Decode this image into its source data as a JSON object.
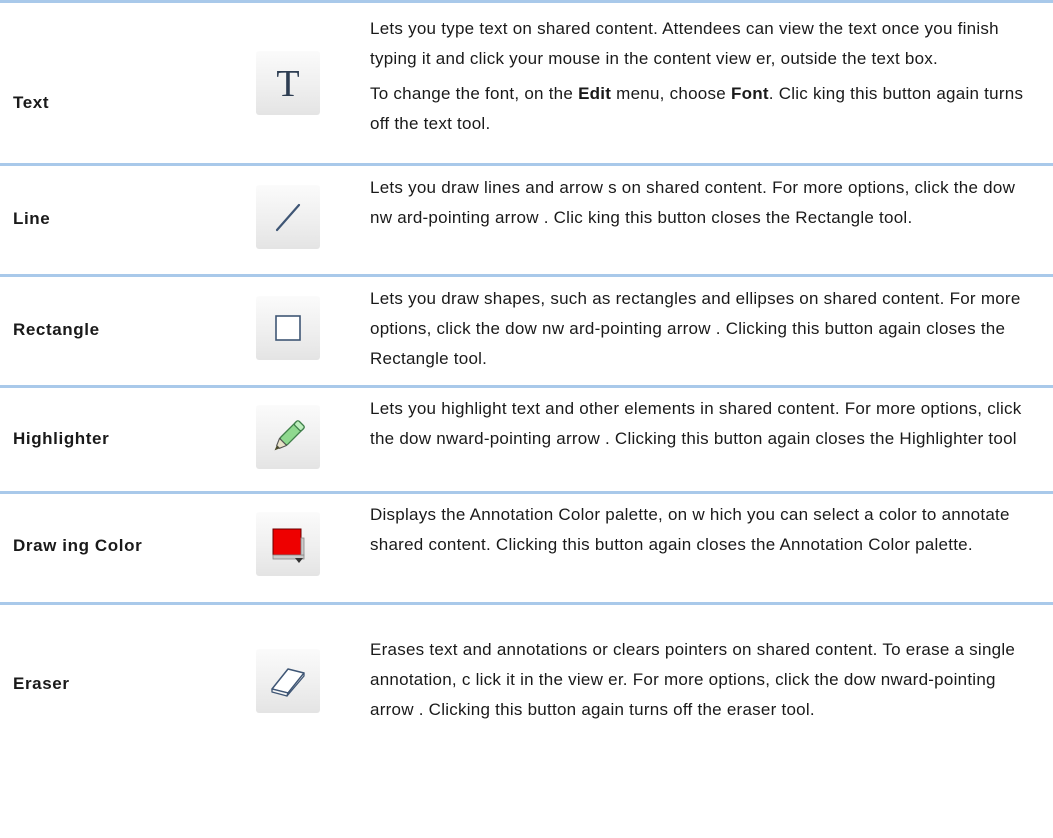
{
  "tools": [
    {
      "name": "Text",
      "icon": "text-tool-icon",
      "paragraphs": [
        [
          "Lets you type text on shared content. Attendees can view the text once you finish typing it and click your mouse in the content view er, outside the text box."
        ],
        [
          "To change the font, on the ",
          "Edit",
          " menu, choose ",
          "Font",
          ". Clic king this button again turns off the text tool."
        ]
      ]
    },
    {
      "name": "Line",
      "icon": "line-tool-icon",
      "paragraphs": [
        [
          "Lets you draw lines and arrow s on shared content. For more options, click the dow nw ard-pointing arrow . Clic king this button closes the Rectangle tool."
        ]
      ]
    },
    {
      "name": "Rectangle",
      "icon": "rectangle-tool-icon",
      "paragraphs": [
        [
          "Lets you draw shapes, such as rectangles and ellipses on shared content. For more options, click the dow nw ard-pointing arrow . Clicking this button again closes the Rectangle tool."
        ]
      ]
    },
    {
      "name": "Highlighter",
      "icon": "highlighter-tool-icon",
      "paragraphs": [
        [
          "Lets you highlight text and other elements in shared content. For more options, click the dow nward-pointing arrow . Clicking this button again closes the Highlighter tool"
        ]
      ]
    },
    {
      "name": "Draw ing Color",
      "icon": "drawing-color-icon",
      "colors": {
        "swatch": "#ee0000",
        "arrow": "#333333"
      },
      "paragraphs": [
        [
          "Displays the Annotation Color palette, on w hich you can select a color to annotate shared content. Clicking this button again closes the Annotation Color palette."
        ]
      ]
    },
    {
      "name": "Eraser",
      "icon": "eraser-tool-icon",
      "paragraphs": [
        [
          "Erases text and annotations or clears pointers on shared content. To erase a single annotation, c lick it in the view er. For more options, click the dow nward-pointing arrow . Clicking this button again turns off the eraser tool."
        ]
      ]
    }
  ],
  "colors": {
    "rule": "#a9c9ea",
    "text": "#1a1a1a"
  }
}
